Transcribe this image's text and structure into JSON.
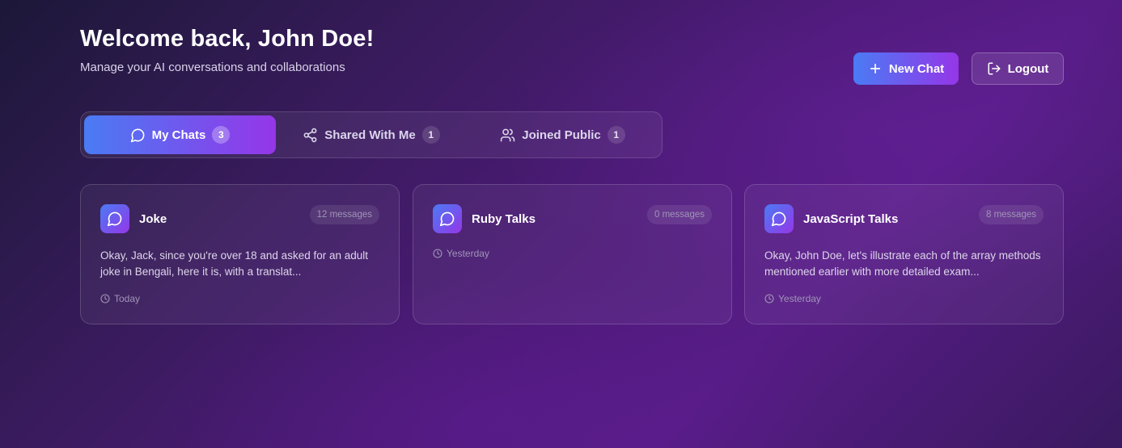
{
  "header": {
    "title": "Welcome back, John Doe!",
    "subtitle": "Manage your AI conversations and collaborations"
  },
  "actions": {
    "new_chat_label": "New Chat",
    "logout_label": "Logout"
  },
  "tabs": [
    {
      "label": "My Chats",
      "count": "3",
      "active": true,
      "icon": "message-circle-icon"
    },
    {
      "label": "Shared With Me",
      "count": "1",
      "active": false,
      "icon": "share-icon"
    },
    {
      "label": "Joined Public",
      "count": "1",
      "active": false,
      "icon": "users-icon"
    }
  ],
  "chats": [
    {
      "title": "Joke",
      "messages": "12 messages",
      "preview": "Okay, Jack, since you're over 18 and asked for an adult joke in Bengali, here it is, with a translat...",
      "time": "Today"
    },
    {
      "title": "Ruby Talks",
      "messages": "0 messages",
      "preview": "",
      "time": "Yesterday"
    },
    {
      "title": "JavaScript Talks",
      "messages": "8 messages",
      "preview": "Okay, John Doe, let's illustrate each of the array methods mentioned earlier with more detailed exam...",
      "time": "Yesterday"
    }
  ],
  "colors": {
    "accent_start": "#4a7bf4",
    "accent_end": "#9536e8"
  }
}
